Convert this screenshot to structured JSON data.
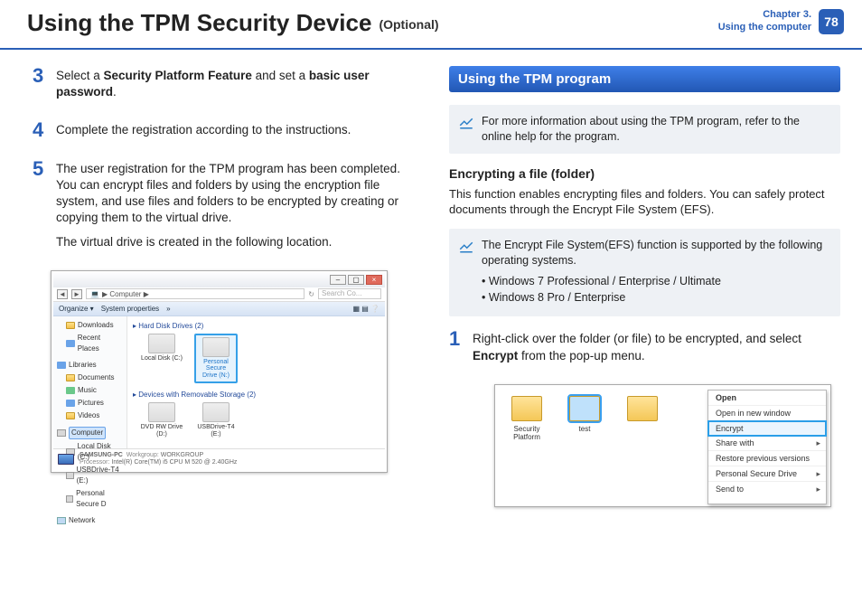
{
  "header": {
    "title": "Using the TPM Security Device",
    "suffix": "(Optional)",
    "chapter_line1": "Chapter 3.",
    "chapter_line2": "Using the computer",
    "page": "78"
  },
  "left": {
    "step3": {
      "num": "3",
      "text_a": "Select a ",
      "b1": "Security Platform Feature",
      "mid": " and set a ",
      "b2": "basic user password",
      "end": "."
    },
    "step4": {
      "num": "4",
      "text": "Complete the registration according to the instructions."
    },
    "step5": {
      "num": "5",
      "p1": "The user registration for the TPM program has been completed. You can encrypt files and folders by using the encryption file system, and use files and folders to be encrypted by creating or copying them to the virtual drive.",
      "p2": "The virtual drive is created in the following location."
    },
    "explorer": {
      "addr_path": "▶ Computer ▶",
      "search_ph": "Search Co...",
      "toolbar": {
        "organize": "Organize ▾",
        "props": "System properties",
        "more": "»"
      },
      "nav": {
        "downloads": "Downloads",
        "recent": "Recent Places",
        "libraries": "Libraries",
        "documents": "Documents",
        "music": "Music",
        "pictures": "Pictures",
        "videos": "Videos",
        "computer": "Computer",
        "localc": "Local Disk (C:)",
        "usbt4": "USBDrive-T4 (E:)",
        "psd": "Personal Secure D",
        "network": "Network"
      },
      "main": {
        "hdd_head": "▸ Hard Disk Drives (2)",
        "localc": "Local Disk (C:)",
        "psd": "Personal Secure Drive (N:)",
        "rem_head": "▸ Devices with Removable Storage (2)",
        "dvd": "DVD RW Drive (D:)",
        "usb": "USBDrive-T4 (E:)"
      },
      "status": {
        "pc": "SAMSUNG-PC",
        "wg_label": "Workgroup:",
        "wg": "WORKGROUP",
        "proc_label": "Processor:",
        "proc": "Intel(R) Core(TM) i5 CPU     M 520  @ 2.40GHz"
      }
    }
  },
  "right": {
    "section_title": "Using the TPM program",
    "note1": "For more information about using the TPM program, refer to the online help for the program.",
    "subhead": "Encrypting a file (folder)",
    "para": "This function enables encrypting files and folders. You can safely protect documents through the Encrypt File System (EFS).",
    "note2": {
      "lead": "The Encrypt File System(EFS) function is supported by the following operating systems.",
      "li1": "Windows 7 Professional / Enterprise / Ultimate",
      "li2": "Windows 8 Pro / Enterprise"
    },
    "step1": {
      "num": "1",
      "a": "Right-click over the folder (or file) to be encrypted, and select ",
      "b": "Encrypt",
      "c": " from the pop-up menu."
    },
    "fig2": {
      "fold1": "Security Platform",
      "fold2": "test",
      "menu": {
        "open": "Open",
        "opennew": "Open in new window",
        "encrypt": "Encrypt",
        "share": "Share with",
        "restore": "Restore previous versions",
        "psd": "Personal Secure Drive",
        "send": "Send to"
      }
    }
  }
}
